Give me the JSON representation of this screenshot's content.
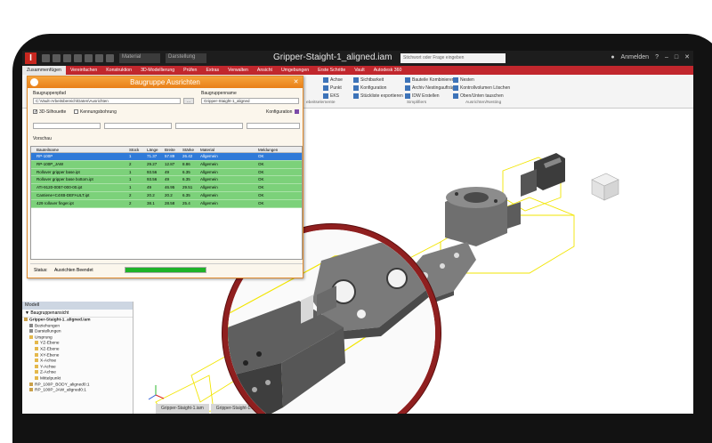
{
  "window": {
    "title": "Gripper-Staight-1_aligned.iam",
    "search_placeholder": "Stichwort oder Frage eingeben",
    "signin": "Anmelden",
    "qat_dropdown_material": "Material",
    "qat_dropdown_appearance": "Darstellung"
  },
  "menu_tabs": [
    "Zusammenfügen",
    "Vereinfachen",
    "Konstruktion",
    "3D-Modellierung",
    "Prüfen",
    "Extras",
    "Verwalten",
    "Ansicht",
    "Umgebungen",
    "Erste Schritte",
    "Vault",
    "Autodesk 360"
  ],
  "ribbon": {
    "group1": [
      "Achse",
      "Punkt",
      "EKS"
    ],
    "group2": [
      "Sichtbarkeit",
      "Konfiguration",
      "Stückliste exportieren"
    ],
    "group3": [
      "Bauteile Kombinieren",
      "Archiv Nestingaufträge",
      "IDW Erstellen"
    ],
    "group4": [
      "Nesten",
      "Kontrollvolumen Löschen",
      "Oben/Unten tauschen"
    ],
    "label_a": "ebeitselemente",
    "label_b": "Simplifiers",
    "label_c": "Ausrichten/Nesting"
  },
  "dialog": {
    "title": "Baugruppe Ausrichten",
    "path_label": "Baugruppenpfad",
    "path_value": "C:\\Vault-Arbeitsbereich\\Daten\\Ausrichten",
    "name_label": "Baugruppenname",
    "name_value": "Gripper-Staight-1_aligned",
    "browse": "...",
    "chk_silhouette": "3D-Silhouette",
    "chk_kennung": "Kennungsbohrung",
    "config_label": "Konfiguration",
    "preview_label": "Vorschau",
    "columns": [
      "Bauteilname",
      "Stück",
      "Länge",
      "Breite",
      "Stärke",
      "Material",
      "Meldungen"
    ],
    "rows": [
      {
        "name": "RP-100P",
        "qty": "1",
        "len": "71.37",
        "wid": "57.89",
        "thk": "26.42",
        "mat": "Allgemein",
        "msg": "OK"
      },
      {
        "name": "RP-100P_JAW",
        "qty": "2",
        "len": "29.27",
        "wid": "12.87",
        "thk": "8.86",
        "mat": "Allgemein",
        "msg": "OK"
      },
      {
        "name": "Rollover gripper base.ipt",
        "qty": "1",
        "len": "93.56",
        "wid": "49",
        "thk": "6.35",
        "mat": "Allgemein",
        "msg": "OK"
      },
      {
        "name": "Rollover gripper base bottom.ipt",
        "qty": "1",
        "len": "93.56",
        "wid": "49",
        "thk": "6.35",
        "mat": "Allgemein",
        "msg": "OK"
      },
      {
        "name": "ATI-9120-0057-000-00.ipt",
        "qty": "1",
        "len": "49",
        "wid": "46.95",
        "thk": "29.51",
        "mat": "Allgemein",
        "msg": "OK"
      },
      {
        "name": "Cantiene+C4XB-DEFAULT.ipt",
        "qty": "2",
        "len": "20.2",
        "wid": "20.2",
        "thk": "6.35",
        "mat": "Allgemein",
        "msg": "OK"
      },
      {
        "name": "429 rollover finger.ipt",
        "qty": "2",
        "len": "38.1",
        "wid": "28.58",
        "thk": "25.4",
        "mat": "Allgemein",
        "msg": "OK"
      }
    ],
    "status_label": "Status:",
    "status_value": "Ausrichten Beendet",
    "progress": 1.0
  },
  "model_panel": {
    "title": "Modell",
    "view_label": "Baugruppenansicht",
    "tree": [
      "Gripper-Staight-1_aligned.iam",
      "Beziehungen",
      "Darstellungen",
      "Ursprung",
      "YZ-Ebene",
      "XZ-Ebene",
      "XY-Ebene",
      "X-Achse",
      "Y-Achse",
      "Z-Achse",
      "Mittelpunkt",
      "RP_100P_BODY_aligned0:1",
      "RP_100P_JAW_aligned0:1"
    ]
  },
  "doc_tabs": [
    "Gripper-Staight-1.iam",
    "Gripper-Staight-1..."
  ],
  "colors": {
    "accent_red": "#c1272d",
    "dialog_orange": "#e97f18",
    "row_green": "#7cd17a",
    "row_selected": "#2f7ad8",
    "magnifier_ring": "#8f1f1f"
  }
}
